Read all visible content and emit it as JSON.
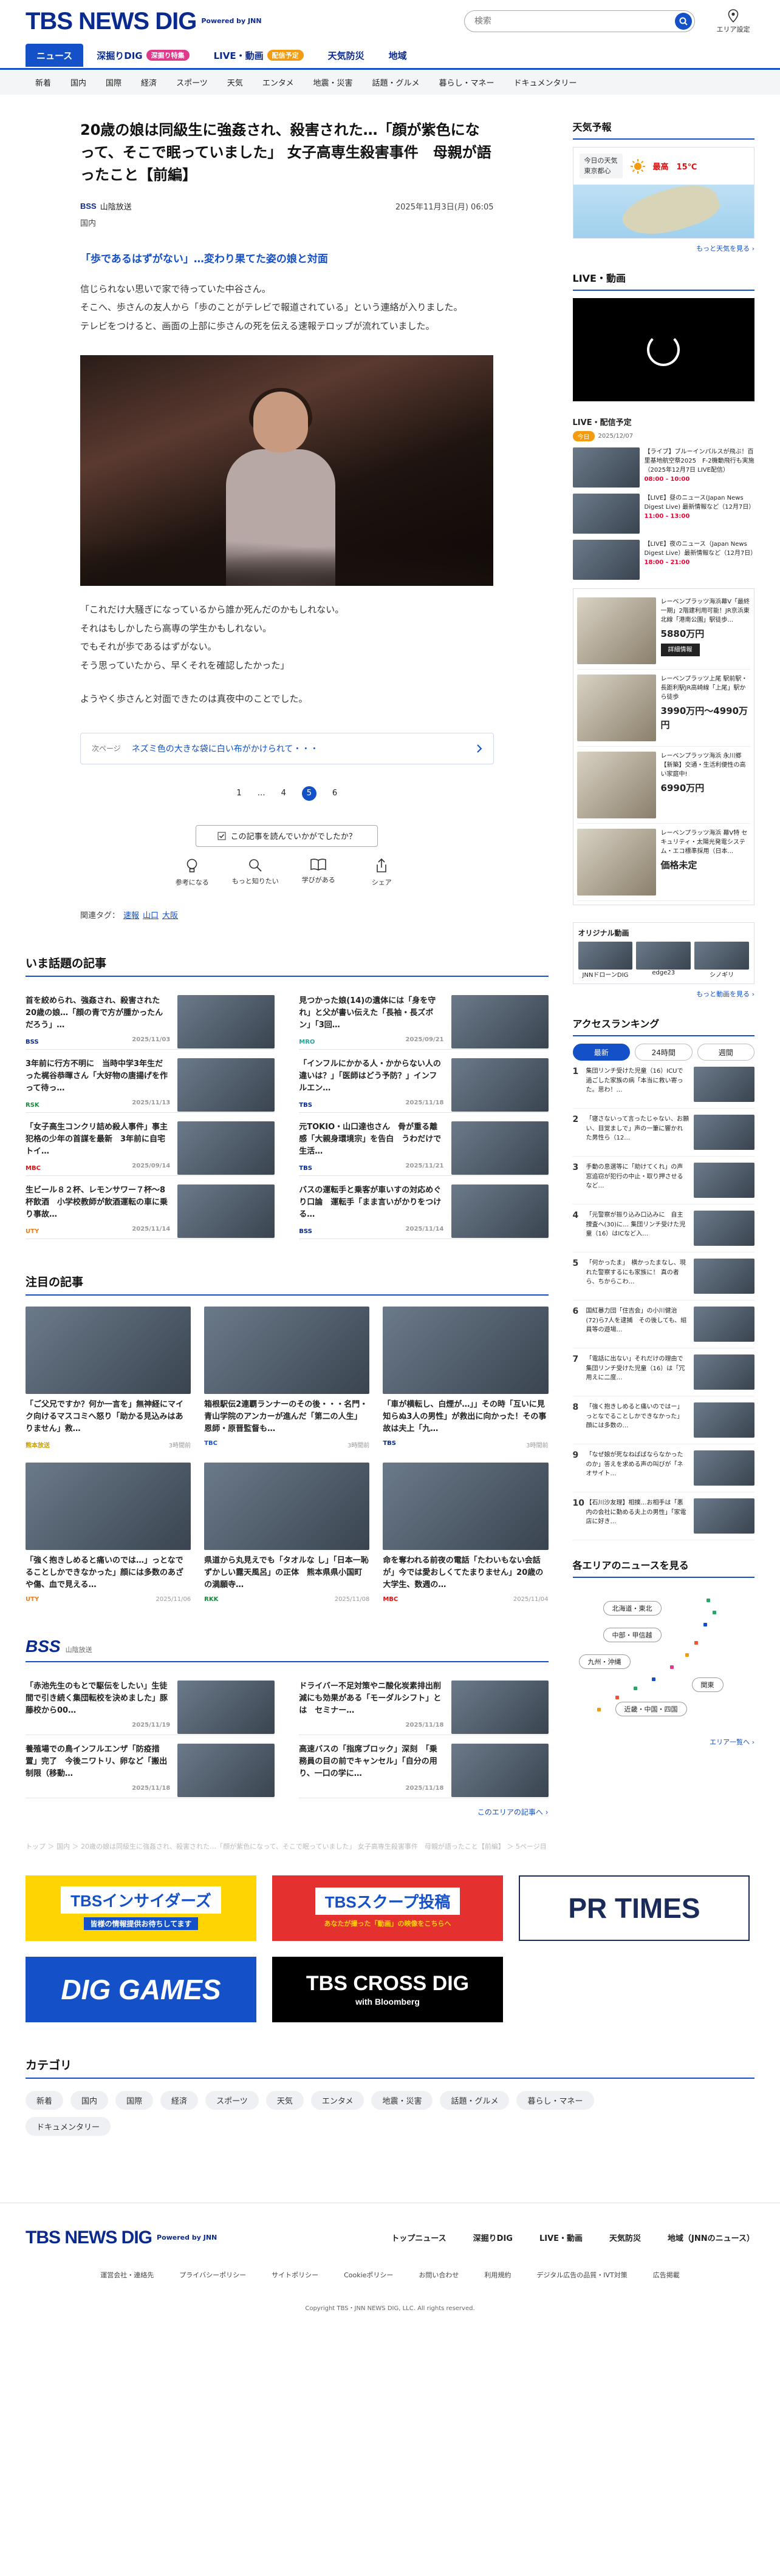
{
  "header": {
    "logo": "TBS NEWS DIG",
    "powered_by": "Powered by JNN",
    "search_placeholder": "検索",
    "area_setting": "エリア設定"
  },
  "nav_main": [
    {
      "label": "ニュース",
      "active": true
    },
    {
      "label": "深掘りDIG",
      "badge": "深掘り特集",
      "badge_color": "#e0398a"
    },
    {
      "label": "LIVE・動画",
      "badge": "配信予定",
      "badge_color": "#f39c12"
    },
    {
      "label": "天気防災"
    },
    {
      "label": "地域"
    }
  ],
  "nav_sub": [
    "新着",
    "国内",
    "国際",
    "経済",
    "スポーツ",
    "天気",
    "エンタメ",
    "地震・災害",
    "話題・グルメ",
    "暮らし・マネー",
    "ドキュメンタリー"
  ],
  "article": {
    "title": "20歳の娘は同級生に強姦され、殺害された…「顔が紫色になって、そこで眠っていました」 女子高専生殺害事件　母親が語ったこと【前編】",
    "source_logo": "BSS",
    "source": "山陰放送",
    "date": "2025年11月3日(月) 06:05",
    "category": "国内",
    "subheading": "「歩であるはずがない」…変わり果てた姿の娘と対面",
    "para1": [
      "信じられない思いで家で待っていた中谷さん。",
      "そこへ、歩さんの友人から「歩のことがテレビで報道されている」という連絡が入りました。",
      "テレビをつけると、画面の上部に歩さんの死を伝える速報テロップが流れていました。"
    ],
    "para2": [
      "「これだけ大騒ぎになっているから誰か死んだのかもしれない。",
      "それはもしかしたら高専の学生かもしれない。",
      "でもそれが歩であるはずがない。",
      "そう思っていたから、早くそれを確認したかった」"
    ],
    "para3": "ようやく歩さんと対面できたのは真夜中のことでした。",
    "next_label": "次ページ",
    "next_title": "ネズミ色の大きな袋に白い布がかけられて・・・",
    "pager": [
      "1",
      "…",
      "4",
      "5",
      "6"
    ],
    "pager_current": "5",
    "reaction_question": "この記事を読んでいかがでしたか？",
    "reactions": [
      {
        "label": "参考になる",
        "icon": "lightbulb-icon"
      },
      {
        "label": "もっと知りたい",
        "icon": "magnifier-icon"
      },
      {
        "label": "学びがある",
        "icon": "book-icon"
      },
      {
        "label": "シェア",
        "icon": "share-icon"
      }
    ],
    "tags_label": "関連タグ：",
    "tags": [
      "速報",
      "山口",
      "大阪"
    ]
  },
  "trending": {
    "title": "いま話題の記事",
    "items": [
      {
        "title": "首を絞められ、強姦され、殺害された20歳の娘…「顔の青で方が腫かったんだろう」…",
        "source": "BSS",
        "source_color": "#0a2a8e",
        "date": "2025/11/03"
      },
      {
        "title": "見つかった娘(14)の遺体には「身を守れ」と父が書い伝えた「長袖・長ズボン」「3回…",
        "source": "MRO",
        "source_color": "#2aa198",
        "date": "2025/09/21"
      },
      {
        "title": "3年前に行方不明に　当時中学3年生だった梶谷恭暉さん「大好物の唐揚げを作って待っ…",
        "source": "RSK",
        "source_color": "#1a8a3a",
        "date": "2025/11/13"
      },
      {
        "title": "「インフルにかかる人・かからない人の違いは？」「医師はどう予防？」インフルエン…",
        "source": "TBS",
        "source_color": "#0a2a8e",
        "date": "2025/11/18"
      },
      {
        "title": "「女子高生コンクリ詰め殺人事件」事主犯格の少年の首謀を最新　3年前に自宅トイ…",
        "source": "MBC",
        "source_color": "#d11",
        "date": "2025/09/14"
      },
      {
        "title": "元TOKIO・山口達也さん　骨が重る離感「大親身環境宗」を告白　うわだけで生活…",
        "source": "TBS",
        "source_color": "#0a2a8e",
        "date": "2025/11/21"
      },
      {
        "title": "生ビール８２杯、レモンサワー７杯〜8杯飲酒　小学校教師が飲酒運転の車に乗り事故…",
        "source": "UTY",
        "source_color": "#e67e22",
        "date": "2025/11/14"
      },
      {
        "title": "バスの運転手と乗客が車いすの対応めぐり口論　運転手「まま言いがかりをつける…",
        "source": "BSS",
        "source_color": "#0a2a8e",
        "date": "2025/11/14"
      }
    ]
  },
  "featured": {
    "title": "注目の記事",
    "items": [
      {
        "title": "「ご父兄ですか？何か一言を」無神経にマイク向けるマスコミへ怒り「助かる見込みはありません」救…",
        "source": "熊本放送",
        "source_color": "#c8a000",
        "date": "3時間前"
      },
      {
        "title": "箱根駅伝2連覇ランナーのその後・・・名門・青山学院のアンカーが進んだ「第二の人生」恩師・原晋監督も…",
        "source": "TBC",
        "source_color": "#1450c8",
        "date": "3時間前"
      },
      {
        "title": "「車が横転し、白煙が…」」その時「互いに見知らぬ3人の男性」が救出に向かった！その事故は夫上「九…",
        "source": "TBS",
        "source_color": "#0a2a8e",
        "date": "3時間前"
      },
      {
        "title": "「強く抱きしめると痛いのでは…」っとなでることしかできなかった」顔には多数のあざや傷、血で見える…",
        "source": "UTY",
        "source_color": "#e67e22",
        "date": "2025/11/06"
      },
      {
        "title": "県道から丸見えでも「タオルな し」「日本一恥ずかしい露天風呂」の正体　熊本県県小国町の満願寺…",
        "source": "RKK",
        "source_color": "#1a8a3a",
        "date": "2025/11/08"
      },
      {
        "title": "命を奪われる前夜の電話「たわいもない会話が」今では愛おしくてたまりません」20歳の大学生、数週の…",
        "source": "MBC",
        "source_color": "#d11",
        "date": "2025/11/04"
      }
    ]
  },
  "bss_section": {
    "logo": "BSS",
    "subtitle": "山陰放送",
    "items": [
      {
        "title": "「赤池先生のもとで駆伝をしたい」生徒間で引き続く集団転校を決めました」豚藤校から00…",
        "date": "2025/11/19"
      },
      {
        "title": "ドライバー不足対策やニ酸化炭素排出削減にも効果がある「モーダルシフト」とは　セミナー…",
        "date": "2025/11/18"
      },
      {
        "title": "養殖場での鳥インフルエンザ「防疫措置」完了　今後ニワトリ、卵など「搬出制限（移動…",
        "date": "2025/11/18"
      },
      {
        "title": "高速バスの「指席ブロック」深刻　「乗務員の目の前でキャンセル」「自分の用り、一口の学に…",
        "date": "2025/11/18"
      }
    ],
    "more": "このエリアの記事へ ›"
  },
  "breadcrumb_foot": "トップ ＞ 国内 ＞ 20歳の娘は同級生に強姦され、殺害された…「顔が紫色になって、そこで眠っていました」 女子高専生殺害事件　母親が語ったこと【前編】 ＞ 5ページ目",
  "banners": [
    {
      "label": "TBSインサイダーズ",
      "sub": "皆様の情報提供お待ちしてます"
    },
    {
      "label": "TBSスクープ投稿",
      "sub": "あなたが撮った「動画」の映像をこちらへ"
    },
    {
      "label": "PR TIMES",
      "sub": ""
    },
    {
      "label": "DIG GAMES",
      "sub": ""
    },
    {
      "label": "TBS CROSS DIG",
      "sub": "with Bloomberg"
    }
  ],
  "categories": {
    "title": "カテゴリ",
    "items": [
      "新着",
      "国内",
      "国際",
      "経済",
      "スポーツ",
      "天気",
      "エンタメ",
      "地震・災害",
      "話題・グルメ",
      "暮らし・マネー",
      "ドキュメンタリー"
    ]
  },
  "footer": {
    "nav": [
      "トップニュース",
      "深掘りDIG",
      "LIVE・動画",
      "天気防災",
      "地域（JNNのニュース）"
    ],
    "links": [
      "運営会社・連絡先",
      "プライバシーポリシー",
      "サイトポリシー",
      "Cookieポリシー",
      "お問い合わせ",
      "利用規約",
      "デジタル広告の品質・IVT対策",
      "広告掲載"
    ],
    "copyright": "Copyright TBS・JNN NEWS DIG, LLC. All rights reserved."
  },
  "sidebar": {
    "weather_title": "天気予報",
    "weather_loc": "今日の天気",
    "weather_city": "東京都心",
    "weather_high_label": "最高",
    "weather_high": "15℃",
    "weather_more": "もっと天気を見る ›",
    "live_title": "LIVE・動画",
    "sched_title": "LIVE・配信予定",
    "sched_tag": "今日",
    "sched_date": "2025/12/07",
    "schedule": [
      {
        "title": "【ライブ】ブルーインパルスが飛ぶ！百里基地航空祭2025　F-2機動飛行も実施（2025年12月7日 LIVE配信）",
        "time": "08:00 - 10:00"
      },
      {
        "title": "【LIVE】昼のニュース(Japan News Digest Live) 最新情報など（12月7日）",
        "time": "11:00 - 13:00"
      },
      {
        "title": "【LIVE】夜のニュース（Japan News Digest Live）最新情報など（12月7日）",
        "time": "18:00 - 21:00"
      }
    ],
    "ads": [
      {
        "title": "レーベンプラッツ海浜幕V「最終一期」2階建利用可能！JR京浜東北線「港南公園」駅徒歩...",
        "price": "5880万円",
        "btn": "詳細情報"
      },
      {
        "title": "レーベンプラッツ上尾 駅前駅・長距利駅JR高崎線「上尾」駅から徒歩",
        "price": "3990万円～4990万円",
        "btn": ""
      },
      {
        "title": "レーベンプラッツ海浜 永川郷【新築】交通・生活利便性の高い家庭中!",
        "price": "6990万円",
        "btn": ""
      },
      {
        "title": "レーベンプラッツ海浜 幕V特 セキュリティ・太陽光発電システム・エコ標準採用（日本...",
        "price": "価格未定",
        "btn": ""
      }
    ],
    "orig_title": "オリジナル動画",
    "orig_items": [
      "JNNドローンDIG",
      "edge23",
      "シノギリ"
    ],
    "orig_more": "もっと動画を見る ›",
    "ranking_title": "アクセスランキング",
    "ranking_tabs": [
      "最新",
      "24時間",
      "週間"
    ],
    "ranking": [
      "集団リンチ受けた児童（16）ICUで過ごした家族の病「本当に救い寄った。思わ！…",
      "「寝さないって言ったじゃない、お願い、目覚ましで」声の一筆に響かれた男性ら（12…",
      "手動の息選等に「助けてくれ」の声　窓追窃が犯行の中止・取り押させるなど…",
      "「元警察が振り込み口込みに　自主捜査へ(30)に… 集団リンチ受けた児童（16）はICなど入…",
      "「何かったま」　横かったまなし、現れた警察するにも家族に！ 真の者ら、ちからこわ…",
      "国紅暴力団「住吉会」の小川健治(72)ら7人を逮捕　その後しても、組員等の遊場…",
      "「電話に出ない」それだけの理由で集団リンチ受けた児童（16）は「冗用えに二度…",
      "「強く抱きしめると痛いのではー」っとなでることしかできなかった」顔には多数の…",
      "「なぜ娘が死なねばばならなかったのか」答えを求める声の叫びが「ネオサイト…",
      "【石川沙友理】相撲…お相手は「悪内の会社に勤める夫上の男性」「家電店に好き…"
    ],
    "area_title": "各エリアのニュースを見る",
    "areas": [
      "北海道・東北",
      "中部・甲信越",
      "九州・沖縄",
      "関東",
      "近畿・中国・四国"
    ],
    "area_more": "エリア一覧へ ›"
  }
}
